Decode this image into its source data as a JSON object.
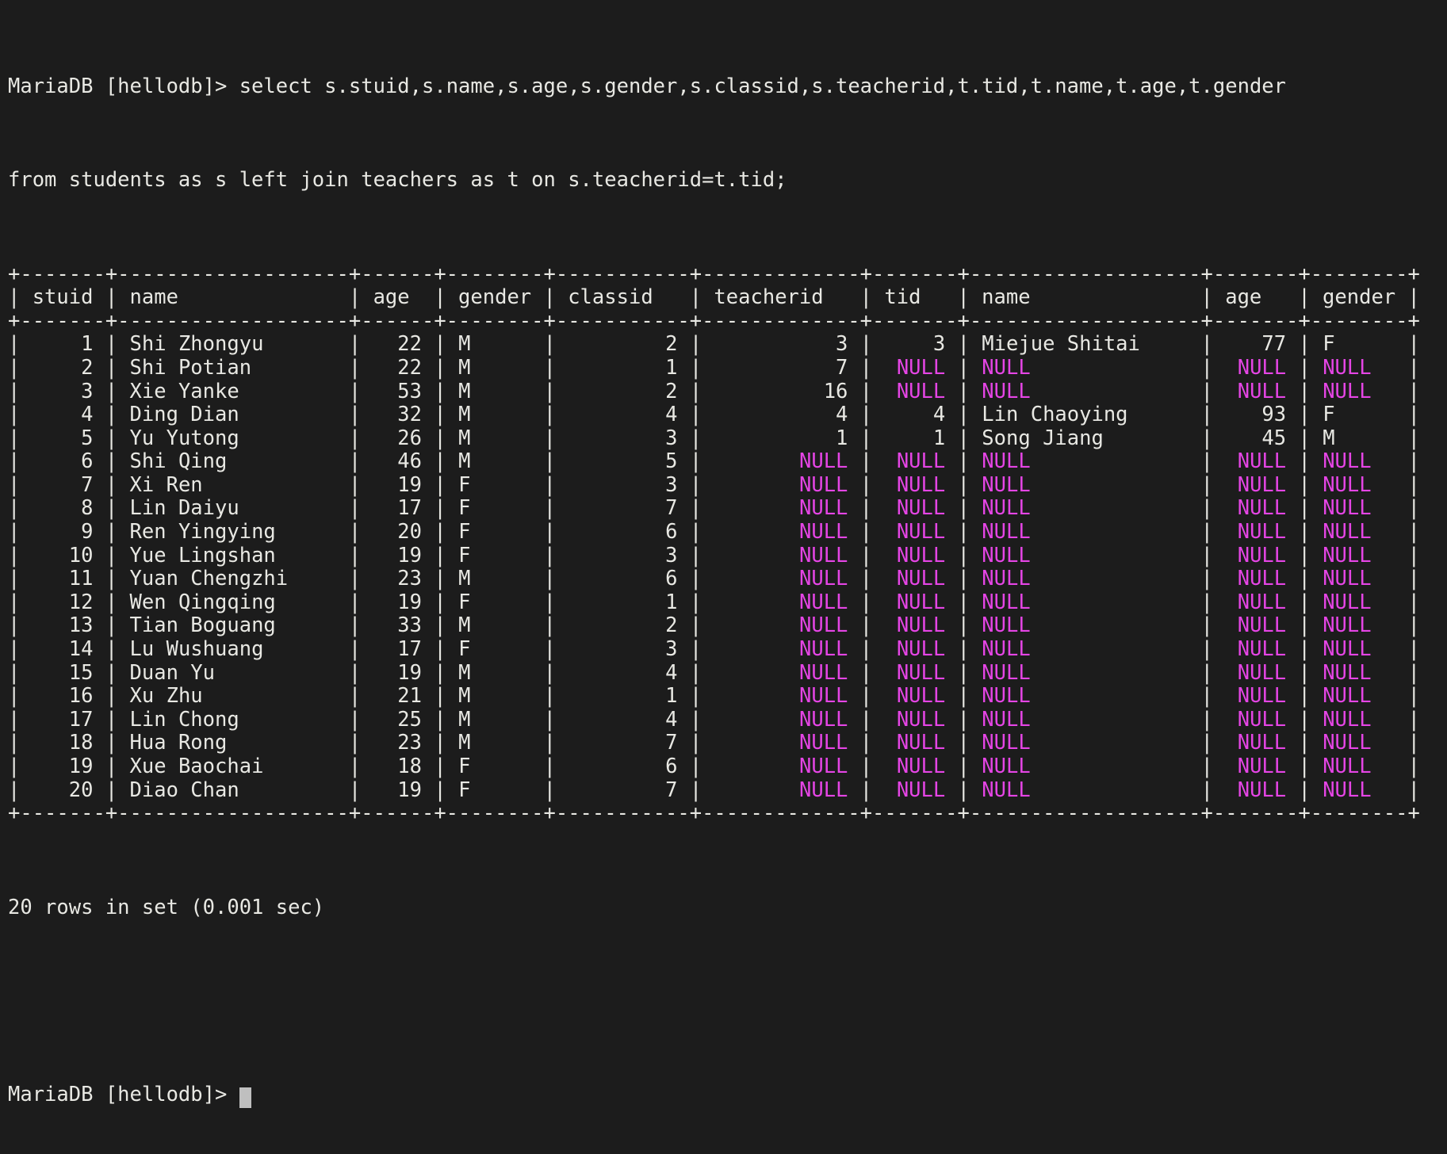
{
  "terminal": {
    "prompt": "MariaDB [hellodb]> ",
    "command_line_1": "select s.stuid,s.name,s.age,s.gender,s.classid,s.teacherid,t.tid,t.name,t.age,t.gender",
    "command_line_2": "from students as s left join teachers as t on s.teacherid=t.tid;",
    "result_status": "20 rows in set (0.001 sec)",
    "final_prompt": "MariaDB [hellodb]> ",
    "colors": {
      "background": "#1c1c1c",
      "foreground": "#e8e8e3",
      "null_value": "#e545e5",
      "cursor": "#bfbfbf"
    }
  },
  "table": {
    "columns": [
      {
        "name": "stuid",
        "width": 5,
        "align": "right"
      },
      {
        "name": "name",
        "width": 17,
        "align": "left"
      },
      {
        "name": "age",
        "width": 4,
        "align": "right"
      },
      {
        "name": "gender",
        "width": 6,
        "align": "left"
      },
      {
        "name": "classid",
        "width": 9,
        "align": "right"
      },
      {
        "name": "teacherid",
        "width": 11,
        "align": "right"
      },
      {
        "name": "tid",
        "width": 5,
        "align": "right"
      },
      {
        "name": "name",
        "width": 17,
        "align": "left"
      },
      {
        "name": "age",
        "width": 5,
        "align": "right"
      },
      {
        "name": "gender",
        "width": 6,
        "align": "left"
      }
    ],
    "rows": [
      [
        "1",
        "Shi Zhongyu",
        "22",
        "M",
        "2",
        "3",
        "3",
        "Miejue Shitai",
        "77",
        "F"
      ],
      [
        "2",
        "Shi Potian",
        "22",
        "M",
        "1",
        "7",
        "NULL",
        "NULL",
        "NULL",
        "NULL"
      ],
      [
        "3",
        "Xie Yanke",
        "53",
        "M",
        "2",
        "16",
        "NULL",
        "NULL",
        "NULL",
        "NULL"
      ],
      [
        "4",
        "Ding Dian",
        "32",
        "M",
        "4",
        "4",
        "4",
        "Lin Chaoying",
        "93",
        "F"
      ],
      [
        "5",
        "Yu Yutong",
        "26",
        "M",
        "3",
        "1",
        "1",
        "Song Jiang",
        "45",
        "M"
      ],
      [
        "6",
        "Shi Qing",
        "46",
        "M",
        "5",
        "NULL",
        "NULL",
        "NULL",
        "NULL",
        "NULL"
      ],
      [
        "7",
        "Xi Ren",
        "19",
        "F",
        "3",
        "NULL",
        "NULL",
        "NULL",
        "NULL",
        "NULL"
      ],
      [
        "8",
        "Lin Daiyu",
        "17",
        "F",
        "7",
        "NULL",
        "NULL",
        "NULL",
        "NULL",
        "NULL"
      ],
      [
        "9",
        "Ren Yingying",
        "20",
        "F",
        "6",
        "NULL",
        "NULL",
        "NULL",
        "NULL",
        "NULL"
      ],
      [
        "10",
        "Yue Lingshan",
        "19",
        "F",
        "3",
        "NULL",
        "NULL",
        "NULL",
        "NULL",
        "NULL"
      ],
      [
        "11",
        "Yuan Chengzhi",
        "23",
        "M",
        "6",
        "NULL",
        "NULL",
        "NULL",
        "NULL",
        "NULL"
      ],
      [
        "12",
        "Wen Qingqing",
        "19",
        "F",
        "1",
        "NULL",
        "NULL",
        "NULL",
        "NULL",
        "NULL"
      ],
      [
        "13",
        "Tian Boguang",
        "33",
        "M",
        "2",
        "NULL",
        "NULL",
        "NULL",
        "NULL",
        "NULL"
      ],
      [
        "14",
        "Lu Wushuang",
        "17",
        "F",
        "3",
        "NULL",
        "NULL",
        "NULL",
        "NULL",
        "NULL"
      ],
      [
        "15",
        "Duan Yu",
        "19",
        "M",
        "4",
        "NULL",
        "NULL",
        "NULL",
        "NULL",
        "NULL"
      ],
      [
        "16",
        "Xu Zhu",
        "21",
        "M",
        "1",
        "NULL",
        "NULL",
        "NULL",
        "NULL",
        "NULL"
      ],
      [
        "17",
        "Lin Chong",
        "25",
        "M",
        "4",
        "NULL",
        "NULL",
        "NULL",
        "NULL",
        "NULL"
      ],
      [
        "18",
        "Hua Rong",
        "23",
        "M",
        "7",
        "NULL",
        "NULL",
        "NULL",
        "NULL",
        "NULL"
      ],
      [
        "19",
        "Xue Baochai",
        "18",
        "F",
        "6",
        "NULL",
        "NULL",
        "NULL",
        "NULL",
        "NULL"
      ],
      [
        "20",
        "Diao Chan",
        "19",
        "F",
        "7",
        "NULL",
        "NULL",
        "NULL",
        "NULL",
        "NULL"
      ]
    ]
  }
}
